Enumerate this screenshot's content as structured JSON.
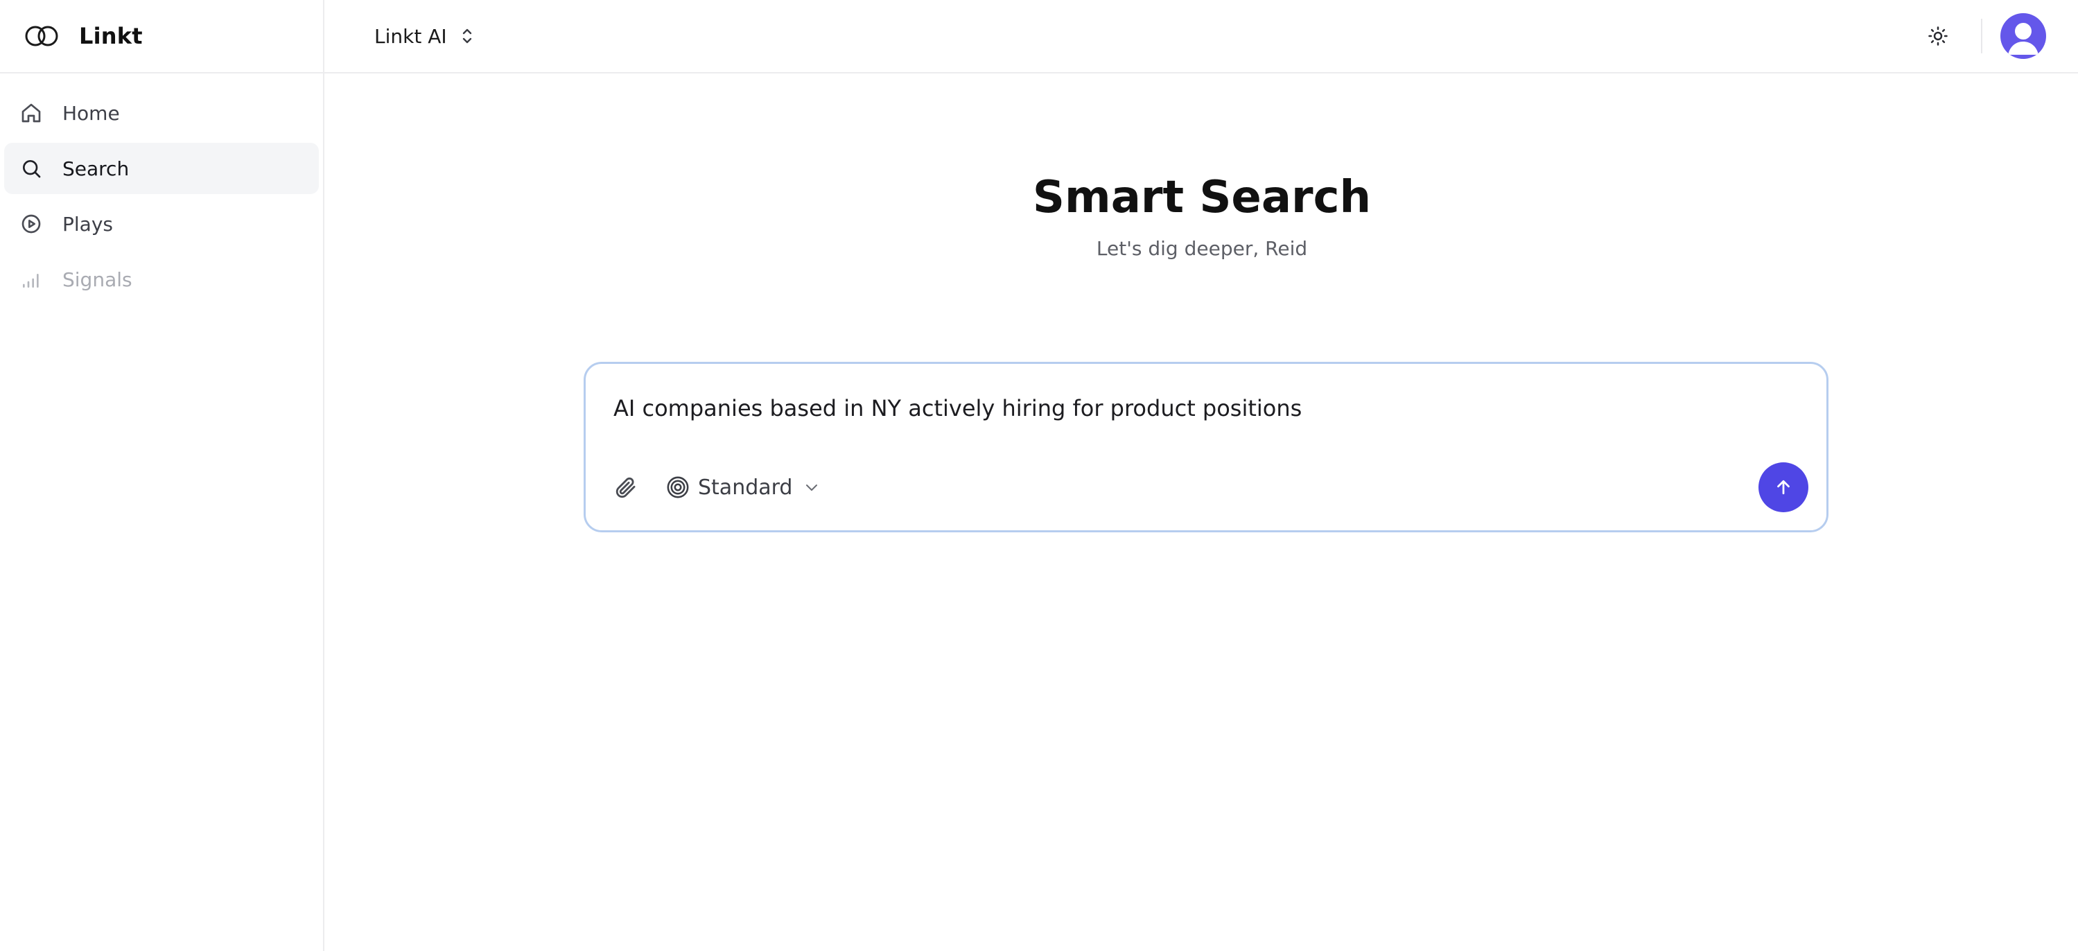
{
  "app": {
    "name": "Linkt"
  },
  "sidebar": {
    "items": [
      {
        "label": "Home",
        "icon": "home-icon",
        "active": false
      },
      {
        "label": "Search",
        "icon": "search-icon",
        "active": true
      },
      {
        "label": "Plays",
        "icon": "play-circle-icon",
        "active": false
      },
      {
        "label": "Signals",
        "icon": "signal-bars-icon",
        "active": false,
        "disabled": true
      }
    ]
  },
  "header": {
    "workspace": "Linkt AI",
    "theme_icon": "sun-icon",
    "avatar_icon": "user-avatar-icon"
  },
  "main": {
    "title": "Smart Search",
    "subtitle": "Let's dig deeper, Reid",
    "query": "AI companies based in NY actively hiring for product positions",
    "mode": "Standard",
    "mode_icon": "target-icon",
    "attach_icon": "paperclip-icon",
    "send_icon": "arrow-up-icon"
  },
  "colors": {
    "accent": "#4f46e5",
    "avatar": "#6457ea",
    "input_border": "#b6cdef",
    "active_nav_bg": "#f4f5f7"
  }
}
